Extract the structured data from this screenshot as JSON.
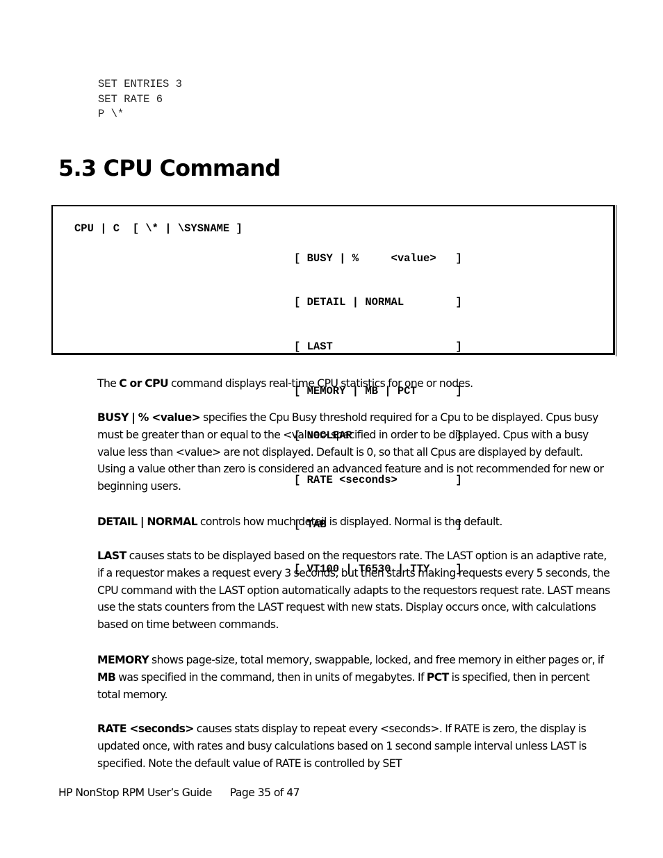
{
  "code_example": {
    "lines": [
      "SET ENTRIES 3",
      "SET RATE 6",
      "P \\*"
    ]
  },
  "section": {
    "heading": "5.3 CPU Command"
  },
  "syntax": {
    "command": "CPU | C  [ \\* | \\SYSNAME ]",
    "options": [
      "[ BUSY | %     <value>   ]",
      "[ DETAIL | NORMAL        ]",
      "[ LAST                   ]",
      "[ MEMORY | MB | PCT      ]",
      "[ NOCLEAR                ]",
      "[ RATE <seconds>         ]",
      "[ TAB                    ]",
      "[ VT100 | T6530 | TTY    ]"
    ]
  },
  "paragraphs": {
    "intro": {
      "pre": "The ",
      "term": "C or CPU",
      "text": " command displays real-time CPU statistics for one or nodes."
    },
    "busy": {
      "term": "BUSY | % <value>",
      "text": " specifies the Cpu Busy threshold required for a Cpu to be displayed. Cpus busy must be greater than or equal to the <value> specified in order to be displayed.  Cpus with a busy value less than <value> are not displayed. Default is 0, so that all Cpus are displayed by default.  Using a value other than zero is considered an advanced feature and is not recommended for new or beginning users."
    },
    "detail": {
      "term": "DETAIL | NORMAL",
      "text": " controls how much detail is displayed.  Normal is the default."
    },
    "last": {
      "term": "LAST",
      "text": " causes stats to be displayed based on the requestors rate. The LAST option is an adaptive rate, if a requestor makes a request every 3 seconds, but then starts making requests every 5 seconds, the CPU command with the LAST option automatically adapts to the requestors request rate.  LAST means use the stats counters from the LAST request with new stats. Display occurs once, with calculations based on time between commands."
    },
    "memory": {
      "term": "MEMORY",
      "text1": " shows page-size, total memory, swappable, locked, and free memory in either pages or, if ",
      "term2": "MB",
      "text2": " was specified in the command, then in units of megabytes. If ",
      "term3": "PCT",
      "text3": " is specified, then in percent total memory."
    },
    "rate": {
      "term": "RATE <seconds>",
      "text": " causes stats display to repeat every <seconds>. If RATE is zero, the display is updated once, with rates and busy calculations based on 1 second sample interval unless LAST is specified.  Note the default value of RATE is controlled by SET"
    }
  },
  "footer": {
    "title": "HP NonStop RPM User’s Guide",
    "page": "Page 35 of 47"
  }
}
